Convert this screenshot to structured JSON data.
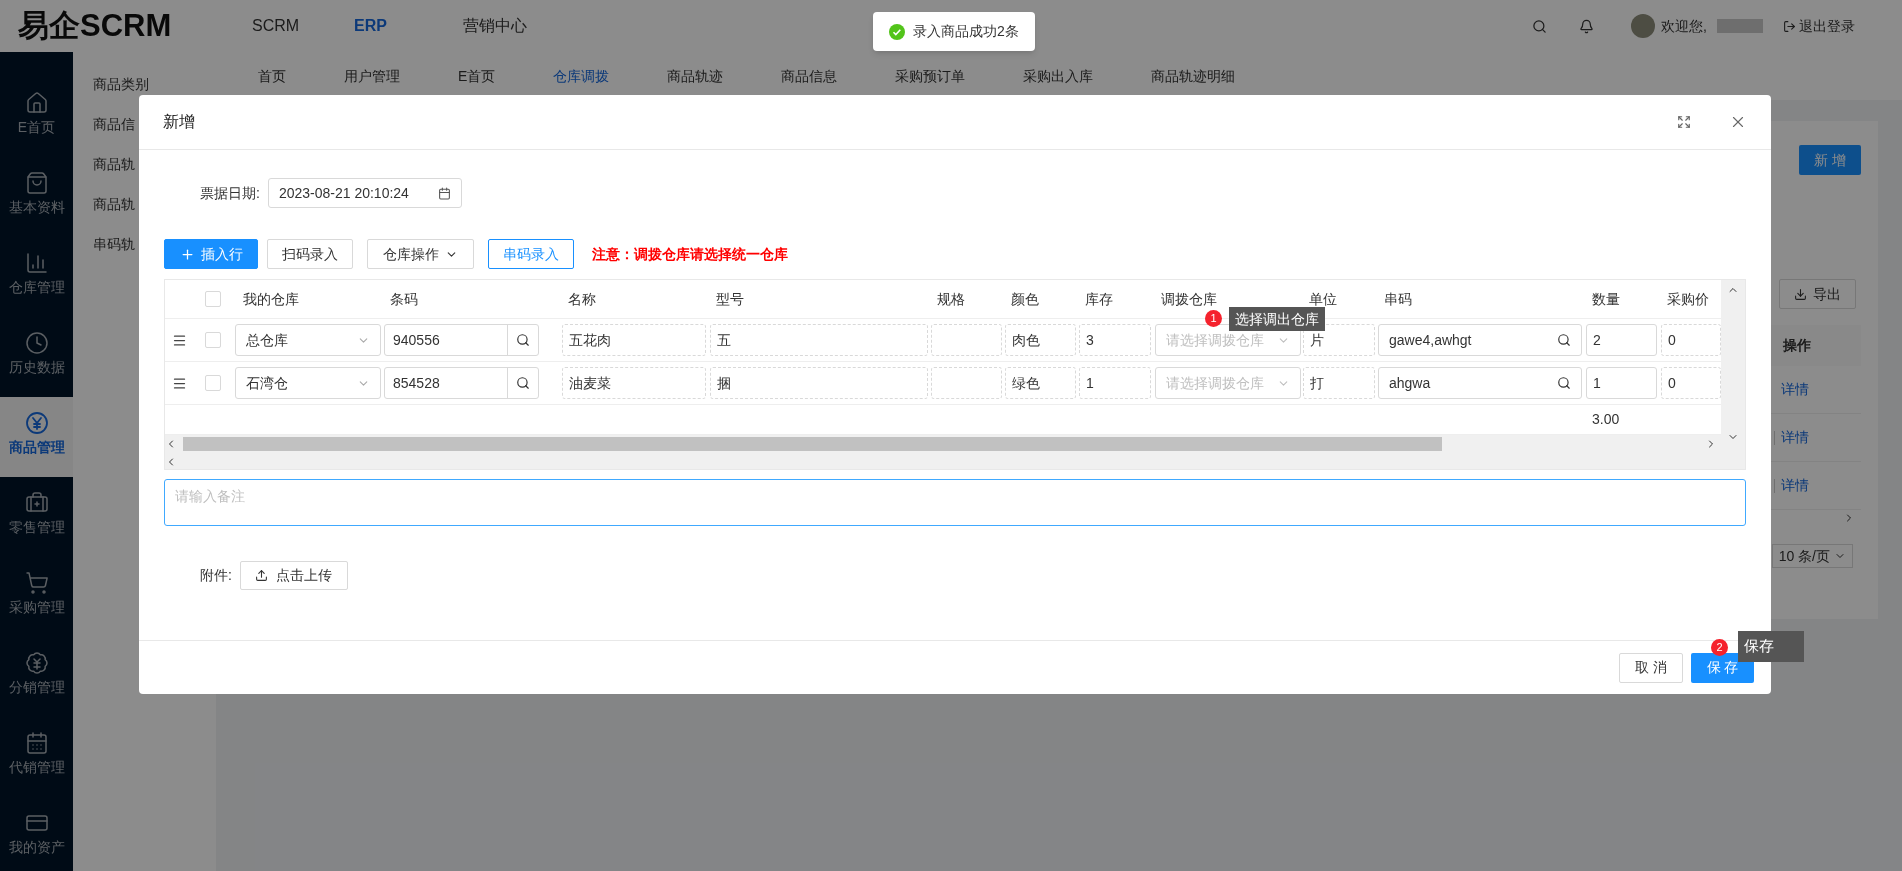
{
  "header": {
    "logo": "易企SCRM",
    "nav": [
      {
        "label": "SCRM",
        "selected": false
      },
      {
        "label": "ERP",
        "selected": true
      },
      {
        "label": "营销中心",
        "selected": false
      }
    ],
    "greeting": "欢迎您,",
    "logout": "退出登录"
  },
  "toast": {
    "text": "录入商品成功2条"
  },
  "sidebar": {
    "items": [
      {
        "label": "E首页",
        "selected": false
      },
      {
        "label": "基本资料",
        "selected": false
      },
      {
        "label": "仓库管理",
        "selected": false
      },
      {
        "label": "历史数据",
        "selected": false
      },
      {
        "label": "商品管理",
        "selected": true
      },
      {
        "label": "零售管理",
        "selected": false
      },
      {
        "label": "采购管理",
        "selected": false
      },
      {
        "label": "分销管理",
        "selected": false
      },
      {
        "label": "代销管理",
        "selected": false
      },
      {
        "label": "我的资产",
        "selected": false
      }
    ]
  },
  "submenu": {
    "items": [
      "商品类别",
      "商品信",
      "商品轨",
      "商品轨",
      "串码轨"
    ]
  },
  "tabs": [
    {
      "label": "首页",
      "selected": false
    },
    {
      "label": "用户管理",
      "selected": false
    },
    {
      "label": "E首页",
      "selected": false
    },
    {
      "label": "仓库调拨",
      "selected": true
    },
    {
      "label": "商品轨迹",
      "selected": false
    },
    {
      "label": "商品信息",
      "selected": false
    },
    {
      "label": "采购预订单",
      "selected": false
    },
    {
      "label": "采购出入库",
      "selected": false
    },
    {
      "label": "商品轨迹明细",
      "selected": false
    }
  ],
  "page": {
    "add_button": "新 增",
    "export_button": "导出",
    "column": "操作",
    "rows": [
      {
        "link": "详情",
        "divider": false
      },
      {
        "link": "详情",
        "divider": true
      },
      {
        "link": "详情",
        "divider": true
      }
    ],
    "page_size": "10 条/页"
  },
  "dialog": {
    "title": "新增",
    "date_label": "票据日期:",
    "date_value": "2023-08-21 20:10:24",
    "toolbar": [
      {
        "label": "插入行",
        "kind": "primary"
      },
      {
        "label": "扫码录入",
        "kind": "default"
      },
      {
        "label": "仓库操作",
        "kind": "dropdown"
      },
      {
        "label": "串码录入",
        "kind": "outline"
      }
    ],
    "notice": "注意：调拨仓库请选择统一仓库",
    "table": {
      "columns": [
        "我的仓库",
        "条码",
        "名称",
        "型号",
        "规格",
        "颜色",
        "库存",
        "调拨仓库",
        "单位",
        "串码",
        "数量",
        "采购价"
      ],
      "all_checked": false,
      "rows": [
        {
          "checked": false,
          "warehouse": "总仓库",
          "barcode": "940556",
          "name": "五花肉",
          "model": "五",
          "color_name": "肉色",
          "stock": "3",
          "transfer_placeholder": "请选择调拨仓库",
          "unit": "片",
          "serial": "gawe4,awhgt",
          "quantity": "2",
          "price": "0"
        },
        {
          "checked": false,
          "warehouse": "石湾仓",
          "barcode": "854528",
          "name": "油麦菜",
          "model": "捆",
          "color_name": "绿色",
          "stock": "1",
          "transfer_placeholder": "请选择调拨仓库",
          "unit": "打",
          "serial": "ahgwa",
          "quantity": "1",
          "price": "0"
        }
      ],
      "total_quantity": "3.00"
    },
    "remark_placeholder": "请输入备注",
    "attachment_label": "附件:",
    "upload_button": "点击上传",
    "cancel_button": "取 消",
    "save_button": "保 存"
  },
  "guides": [
    {
      "number": "1",
      "text": "选择调出仓库"
    },
    {
      "number": "2",
      "text": "保存"
    }
  ]
}
